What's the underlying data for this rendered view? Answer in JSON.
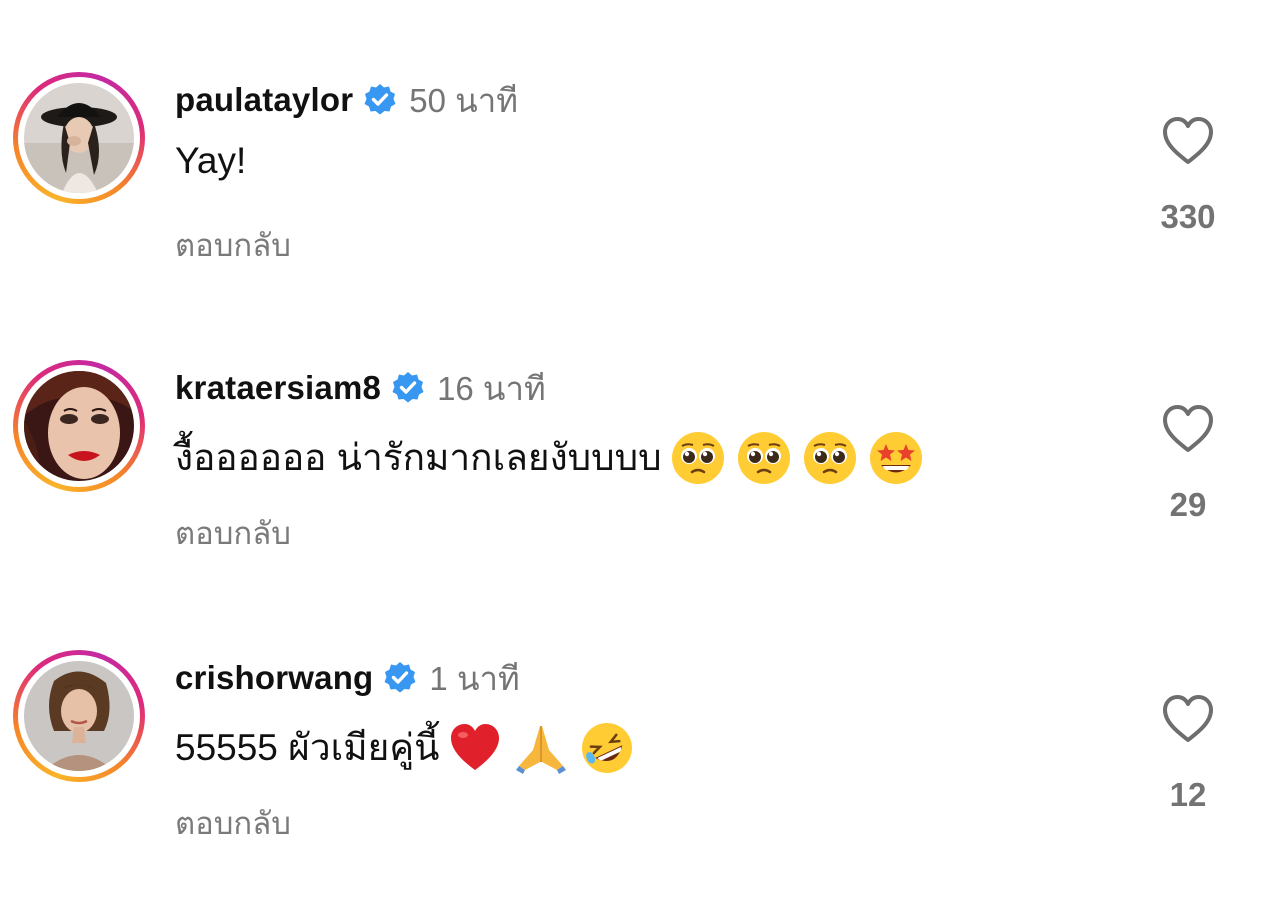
{
  "comments": [
    {
      "username": "paulataylor",
      "verified": true,
      "time": "50 นาที",
      "text": "Yay!",
      "emojis": [],
      "reply_label": "ตอบกลับ",
      "likes": "330",
      "avatar": "profile-photo-woman-black-hat"
    },
    {
      "username": "krataersiam8",
      "verified": true,
      "time": "16 นาที",
      "text": "งื้ออออออ น่ารักมากเลยงับบบบ",
      "emojis": [
        "pleading-face",
        "pleading-face",
        "pleading-face",
        "star-struck"
      ],
      "reply_label": "ตอบกลับ",
      "likes": "29",
      "avatar": "profile-photo-woman-red-lips"
    },
    {
      "username": "crishorwang",
      "verified": true,
      "time": "1 นาที",
      "text": "55555 ผัวเมียคู่นี้",
      "emojis": [
        "red-heart",
        "folded-hands",
        "rolling-on-floor-laughing"
      ],
      "reply_label": "ตอบกลับ",
      "likes": "12",
      "avatar": "profile-photo-woman-portrait"
    }
  ],
  "colors": {
    "verified_badge": "#3897f0",
    "time_text": "#757575",
    "reply_text": "#7a7a7a",
    "like_count": "#737373",
    "story_ring_start": "#f9b429",
    "story_ring_end": "#c32aa3"
  }
}
